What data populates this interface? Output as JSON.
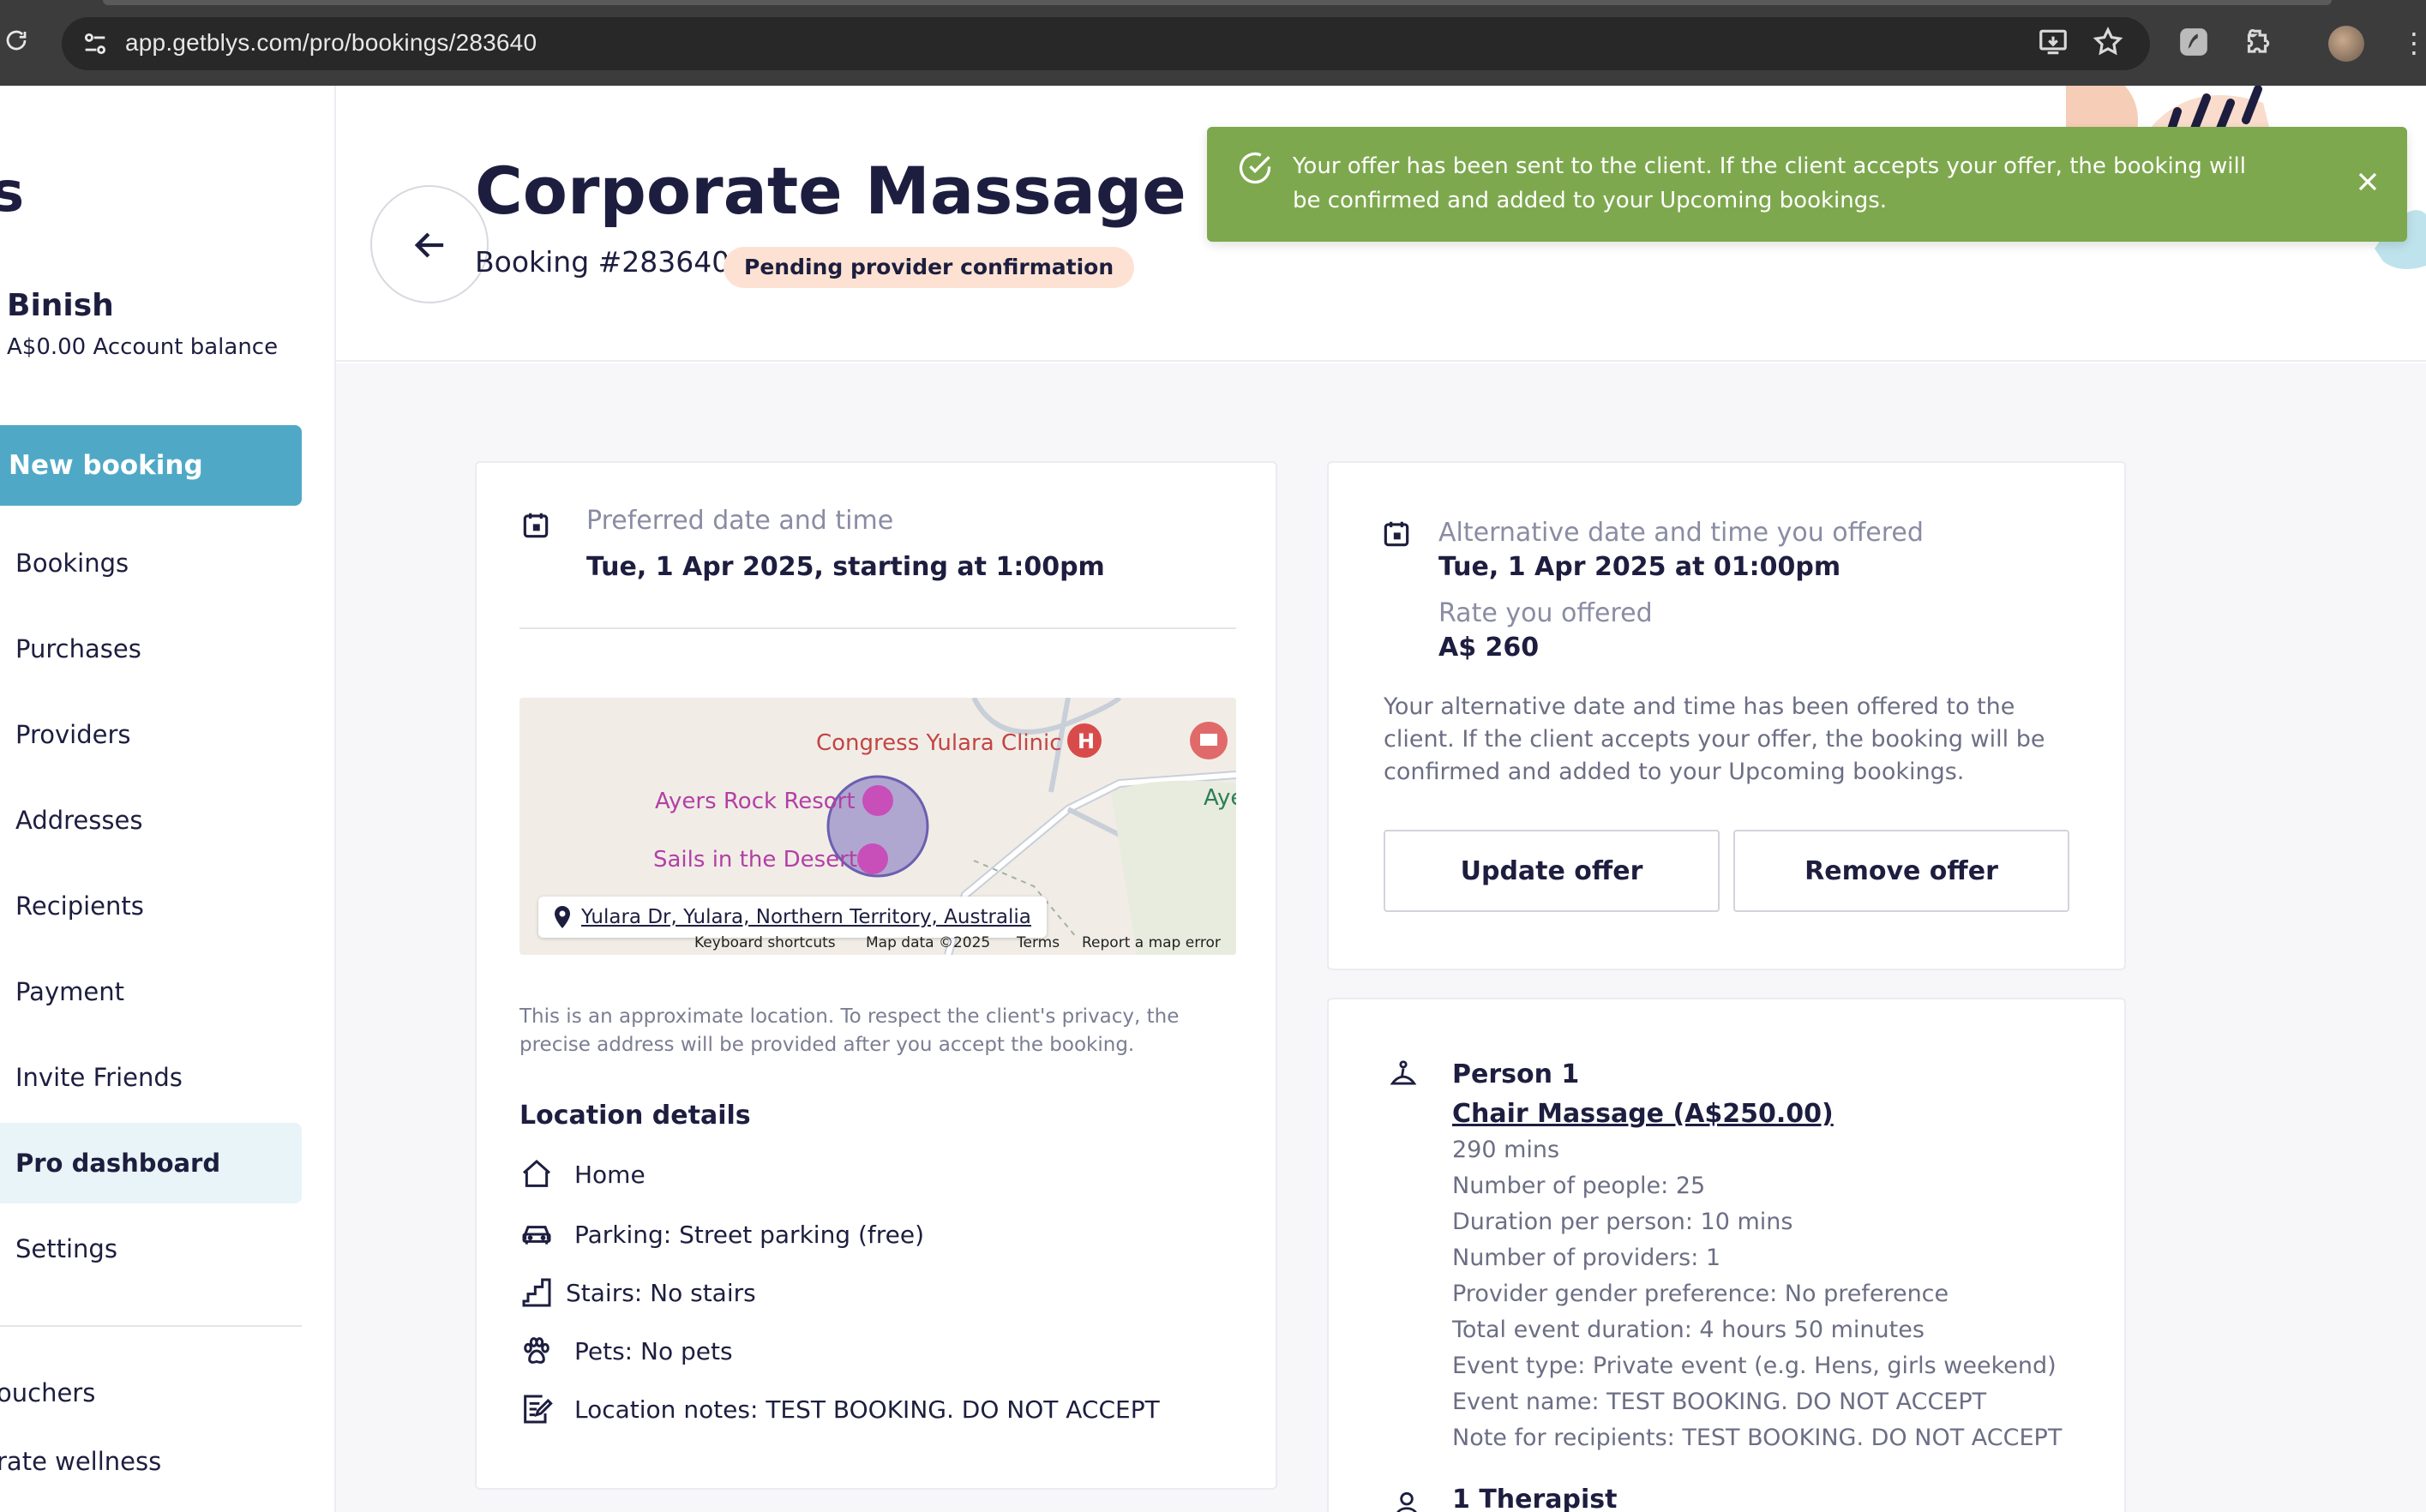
{
  "browser": {
    "url": "app.getblys.com/pro/bookings/283640"
  },
  "sidebar": {
    "logo_fragment": "s",
    "user_name": "Binish",
    "balance": "A$0.00 Account balance",
    "new_booking_label": "New booking",
    "items": [
      {
        "label": "Bookings"
      },
      {
        "label": "Purchases"
      },
      {
        "label": "Providers"
      },
      {
        "label": "Addresses"
      },
      {
        "label": "Recipients"
      },
      {
        "label": "Payment"
      },
      {
        "label": "Invite Friends"
      },
      {
        "label": "Pro dashboard",
        "active": true
      },
      {
        "label": "Settings"
      }
    ],
    "secondary_items": [
      {
        "label": "ouchers"
      },
      {
        "label": "rate wellness"
      }
    ]
  },
  "header": {
    "title": "Corporate Massage | Cha",
    "booking_number": "Booking #283640",
    "status": "Pending provider confirmation"
  },
  "toast": {
    "message": "Your offer has been sent to the client. If the client accepts your offer, the booking will be confirmed and added to your Upcoming bookings."
  },
  "preferred": {
    "label": "Preferred date and time",
    "value": "Tue, 1 Apr 2025, starting at 1:00pm"
  },
  "map": {
    "labels": {
      "clinic": "Congress Yulara Clinic",
      "resort": "Ayers Rock Resort",
      "sails": "Sails in the Desert",
      "edge": "Aye"
    },
    "address": "Yulara Dr, Yulara, Northern Territory, Australia",
    "footer": {
      "shortcuts": "Keyboard shortcuts",
      "data": "Map data ©2025",
      "terms": "Terms",
      "report": "Report a map error"
    }
  },
  "privacy_note": "This is an approximate location. To respect the client's privacy, the precise address will be provided after you accept the booking.",
  "location": {
    "title": "Location details",
    "rows": [
      {
        "icon": "home-icon",
        "text": "Home"
      },
      {
        "icon": "car-icon",
        "text": "Parking: Street parking (free)"
      },
      {
        "icon": "stairs-icon",
        "text": "Stairs: No stairs"
      },
      {
        "icon": "paw-icon",
        "text": "Pets: No pets"
      },
      {
        "icon": "notes-icon",
        "text": "Location notes: TEST BOOKING. DO NOT ACCEPT"
      }
    ]
  },
  "offer": {
    "alt_label": "Alternative date and time you offered",
    "alt_value": "Tue, 1 Apr 2025 at 01:00pm",
    "rate_label": "Rate you offered",
    "rate_value": "A$ 260",
    "description": "Your alternative date and time has been offered to the client. If the client accepts your offer, the booking will be confirmed and added to your Upcoming bookings.",
    "update_label": "Update offer",
    "remove_label": "Remove offer"
  },
  "person": {
    "title": "Person 1",
    "service": "Chair Massage (A$250.00)",
    "details": [
      "290 mins",
      "Number of people: 25",
      "Duration per person: 10 mins",
      "Number of providers: 1",
      "Provider gender preference: No preference",
      "Total event duration: 4 hours 50 minutes",
      "Event type: Private event (e.g. Hens, girls weekend)",
      "Event name: TEST BOOKING. DO NOT ACCEPT",
      "Note for recipients: TEST BOOKING. DO NOT ACCEPT"
    ],
    "therapist": "1 Therapist"
  },
  "colors": {
    "accent": "#4fa9c6",
    "toast": "#7ea84e",
    "badge": "#fde2d3",
    "navy": "#1d1e3f"
  }
}
